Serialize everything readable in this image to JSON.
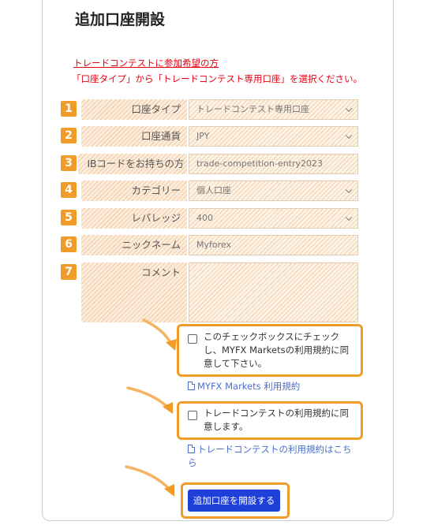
{
  "header": {
    "title": "追加口座開設"
  },
  "notice": {
    "link": "トレードコンテストに参加希望の方",
    "text": "「口座タイプ」から「トレードコンテスト専用口座」を選択ください。"
  },
  "form": {
    "rows": [
      {
        "num": "1",
        "label": "口座タイプ",
        "value": "トレードコンテスト専用口座"
      },
      {
        "num": "2",
        "label": "口座通貨",
        "value": "JPY"
      },
      {
        "num": "3",
        "label": "IBコードをお持ちの方",
        "value": "trade-competition-entry2023"
      },
      {
        "num": "4",
        "label": "カテゴリー",
        "value": "個人口座"
      },
      {
        "num": "5",
        "label": "レバレッジ",
        "value": "400"
      },
      {
        "num": "6",
        "label": "ニックネーム",
        "value": "Myforex"
      },
      {
        "num": "7",
        "label": "コメント",
        "value": ""
      }
    ]
  },
  "consent": {
    "terms_check": "このチェックボックスにチェックし、MYFX Marketsの利用規約に同意して下さい。",
    "terms_check_lines": [
      "このチェックボックスにチェック",
      "し、MYFX Marketsの利用規約に同",
      "意して下さい。"
    ],
    "terms_link": "MYFX Markets 利用規約",
    "contest_check_lines": [
      "トレードコンテストの利用規約に同",
      "意します。"
    ],
    "contest_link_lines": [
      "トレードコンテストの利用規約はこち",
      "ら"
    ]
  },
  "submit": {
    "label": "追加口座を開設する"
  },
  "colors": {
    "accent": "#f19c29",
    "notice": "#e60012",
    "link": "#4b6ec9",
    "button": "#1e3fd8"
  }
}
